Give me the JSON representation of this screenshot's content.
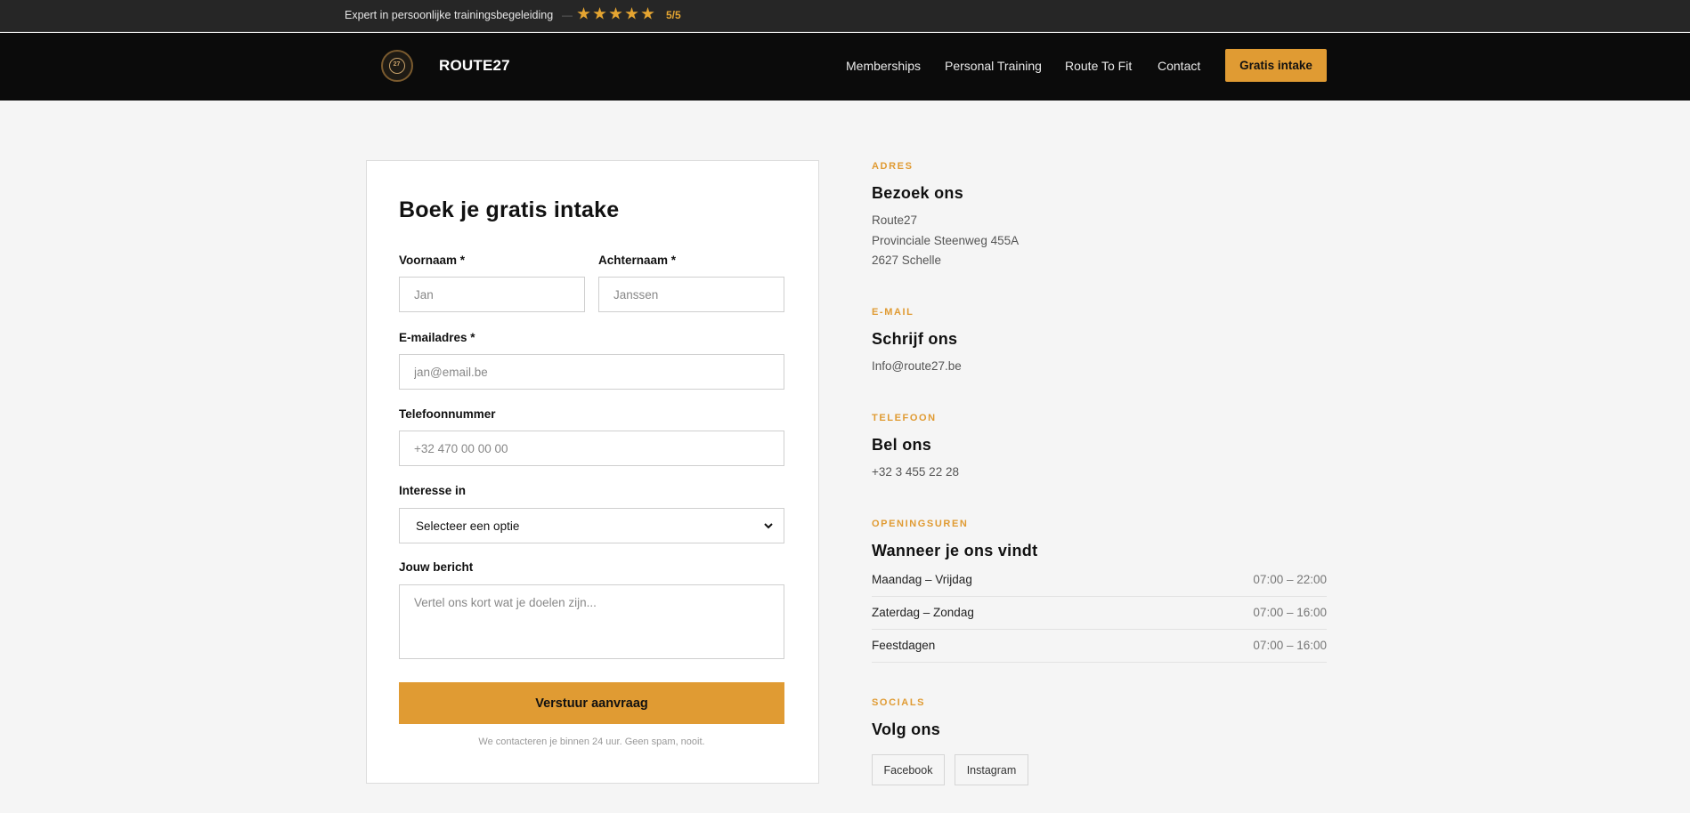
{
  "topbar": {
    "tagline": "Expert in persoonlijke trainingsbegeleiding",
    "separator": "—",
    "stars": 5,
    "rating": "5/5",
    "star_color": "#e5a531"
  },
  "nav": {
    "logo_text": "27",
    "brand": "ROUTE27",
    "links": [
      "Memberships",
      "Personal Training",
      "Route To Fit",
      "Contact"
    ],
    "cta": "Gratis intake"
  },
  "form": {
    "title": "Boek je gratis intake",
    "first_name": {
      "label": "Voornaam *",
      "placeholder": "Jan"
    },
    "last_name": {
      "label": "Achternaam *",
      "placeholder": "Janssen"
    },
    "email": {
      "label": "E-mailadres *",
      "placeholder": "jan@email.be"
    },
    "phone": {
      "label": "Telefoonnummer",
      "placeholder": "+32 470 00 00 00"
    },
    "interest": {
      "label": "Interesse in",
      "selected": "Selecteer een optie"
    },
    "message": {
      "label": "Jouw bericht",
      "placeholder": "Vertel ons kort wat je doelen zijn..."
    },
    "submit": "Verstuur aanvraag",
    "note": "We contacteren je binnen 24 uur. Geen spam, nooit."
  },
  "info": {
    "address": {
      "kicker": "ADRES",
      "heading": "Bezoek ons",
      "lines": [
        "Route27",
        "Provinciale Steenweg 455A",
        "2627 Schelle"
      ]
    },
    "email": {
      "kicker": "E-MAIL",
      "heading": "Schrijf ons",
      "value": "Info@route27.be"
    },
    "phone": {
      "kicker": "TELEFOON",
      "heading": "Bel ons",
      "value": "+32 3 455 22 28"
    },
    "hours": {
      "kicker": "OPENINGSUREN",
      "heading": "Wanneer je ons vindt",
      "rows": [
        {
          "day": "Maandag – Vrijdag",
          "time": "07:00 – 22:00"
        },
        {
          "day": "Zaterdag – Zondag",
          "time": "07:00 – 16:00"
        },
        {
          "day": "Feestdagen",
          "time": "07:00 – 16:00"
        }
      ]
    },
    "socials": {
      "kicker": "SOCIALS",
      "heading": "Volg ons",
      "items": [
        "Facebook",
        "Instagram"
      ]
    }
  },
  "colors": {
    "accent": "#e09b33",
    "topbar_bg": "#262626",
    "nav_bg": "#0b0b0b",
    "page_bg": "#f5f5f5"
  }
}
